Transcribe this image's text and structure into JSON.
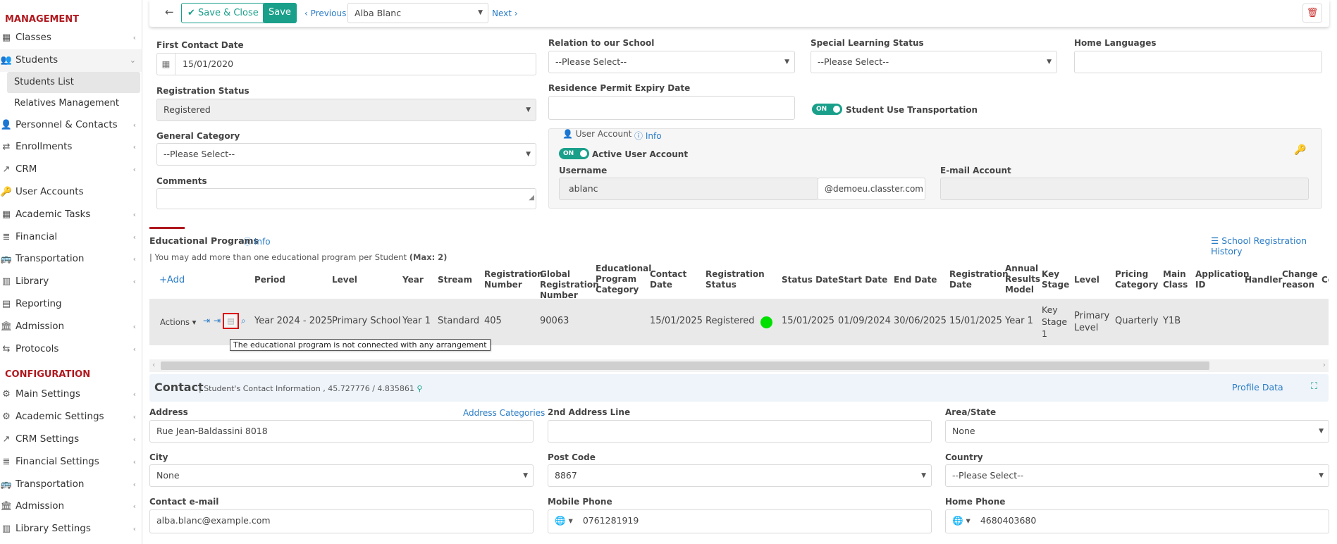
{
  "sidebar": {
    "management_title": "MANAGEMENT",
    "items": [
      {
        "label": "Classes",
        "icon": "classes-icon"
      },
      {
        "label": "Students",
        "icon": "students-icon"
      },
      {
        "label": "Personnel & Contacts",
        "icon": "personnel-icon"
      },
      {
        "label": "Enrollments",
        "icon": "enrollments-icon"
      },
      {
        "label": "CRM",
        "icon": "crm-icon"
      },
      {
        "label": "User Accounts",
        "icon": "user-accounts-icon"
      },
      {
        "label": "Academic Tasks",
        "icon": "academic-tasks-icon"
      },
      {
        "label": "Financial",
        "icon": "financial-icon"
      },
      {
        "label": "Transportation",
        "icon": "bus-icon"
      },
      {
        "label": "Library",
        "icon": "library-icon"
      },
      {
        "label": "Reporting",
        "icon": "reporting-icon"
      },
      {
        "label": "Admission",
        "icon": "admission-icon"
      },
      {
        "label": "Protocols",
        "icon": "protocols-icon"
      }
    ],
    "students_sub": [
      "Students List",
      "Relatives Management"
    ],
    "config_title": "CONFIGURATION",
    "config_items": [
      {
        "label": "Main Settings",
        "icon": "main-settings-icon"
      },
      {
        "label": "Academic Settings",
        "icon": "academic-settings-icon"
      },
      {
        "label": "CRM Settings",
        "icon": "crm-settings-icon"
      },
      {
        "label": "Financial Settings",
        "icon": "financial-settings-icon"
      },
      {
        "label": "Transportation",
        "icon": "bus-icon"
      },
      {
        "label": "Admission",
        "icon": "admission-icon"
      },
      {
        "label": "Library Settings",
        "icon": "library-settings-icon"
      }
    ]
  },
  "toolbar": {
    "save_close": "Save & Close",
    "save": "Save",
    "previous": "Previous",
    "student": "Alba Blanc",
    "next": "Next"
  },
  "form": {
    "first_contact_label": "First Contact Date",
    "first_contact_value": "15/01/2020",
    "relation_label": "Relation to our School",
    "relation_value": "--Please Select--",
    "special_label": "Special Learning Status",
    "special_value": "--Please Select--",
    "home_lang_label": "Home Languages",
    "reg_status_label": "Registration Status",
    "reg_status_value": "Registered",
    "residence_label": "Residence Permit Expiry Date",
    "transport_toggle": "ON",
    "transport_label": "Student Use Transportation",
    "general_cat_label": "General Category",
    "general_cat_value": "--Please Select--",
    "user_account_label": "User Account",
    "info": "Info",
    "active_toggle": "ON",
    "active_label": "Active User Account",
    "username_label": "Username",
    "username_value": "ablanc",
    "domain": "@demoeu.classter.com",
    "email_label": "E-mail Account",
    "comments_label": "Comments"
  },
  "programs": {
    "title": "Educational Programs",
    "info": "Info",
    "history": "School Registration History",
    "note": "| You may add more than one educational program per Student",
    "note_max": "(Max: 2)",
    "add": "Add",
    "actions": "Actions",
    "headers": {
      "period": "Period",
      "level": "Level",
      "year": "Year",
      "stream": "Stream",
      "reg_num": "Registration Number",
      "global_reg": "Global Registration Number",
      "edu_cat": "Educational Program Category",
      "contact_date": "Contact Date",
      "reg_status": "Registration Status",
      "status_date": "Status Date",
      "start_date": "Start Date",
      "end_date": "End Date",
      "reg_date": "Registration Date",
      "annual": "Annual Results Model",
      "key_stage": "Key Stage",
      "level2": "Level",
      "pricing": "Pricing Category",
      "main_class": "Main Class",
      "app_id": "Application ID",
      "handler": "Handler",
      "change": "Change reason",
      "more": "Co"
    },
    "row": {
      "period": "Year 2024 - 2025",
      "level": "Primary School",
      "year": "Year 1",
      "stream": "Standard",
      "reg_num": "405",
      "global_reg": "90063",
      "contact_date": "15/01/2025",
      "reg_status": "Registered",
      "status_color": "#00e000",
      "status_date": "15/01/2025",
      "start_date": "01/09/2024",
      "end_date": "30/06/2025",
      "reg_date": "15/01/2025",
      "annual": "Year 1",
      "key_stage": "Key Stage 1",
      "level2": "Primary Level",
      "pricing": "Quarterly",
      "main_class": "Y1B"
    },
    "tooltip": "The educational program is not connected with any arrangement"
  },
  "contact": {
    "title": "Contact",
    "subtitle": "| Student's Contact Information , 45.727776 / 4.835861",
    "profile": "Profile Data",
    "address_label": "Address",
    "address_cat": "Address Categories",
    "address_value": "Rue Jean-Baldassini 8018",
    "address2_label": "2nd Address Line",
    "area_label": "Area/State",
    "area_value": "None",
    "city_label": "City",
    "city_value": "None",
    "post_label": "Post Code",
    "post_value": "8867",
    "country_label": "Country",
    "country_value": "--Please Select--",
    "email_label": "Contact e-mail",
    "email_value": "alba.blanc@example.com",
    "mobile_label": "Mobile Phone",
    "mobile_value": "0761281919",
    "home_label": "Home Phone",
    "home_value": "4680403680"
  },
  "colors": {
    "accent": "#1aa08a",
    "brand_red": "#b0191f",
    "link": "#2a7cc7"
  }
}
